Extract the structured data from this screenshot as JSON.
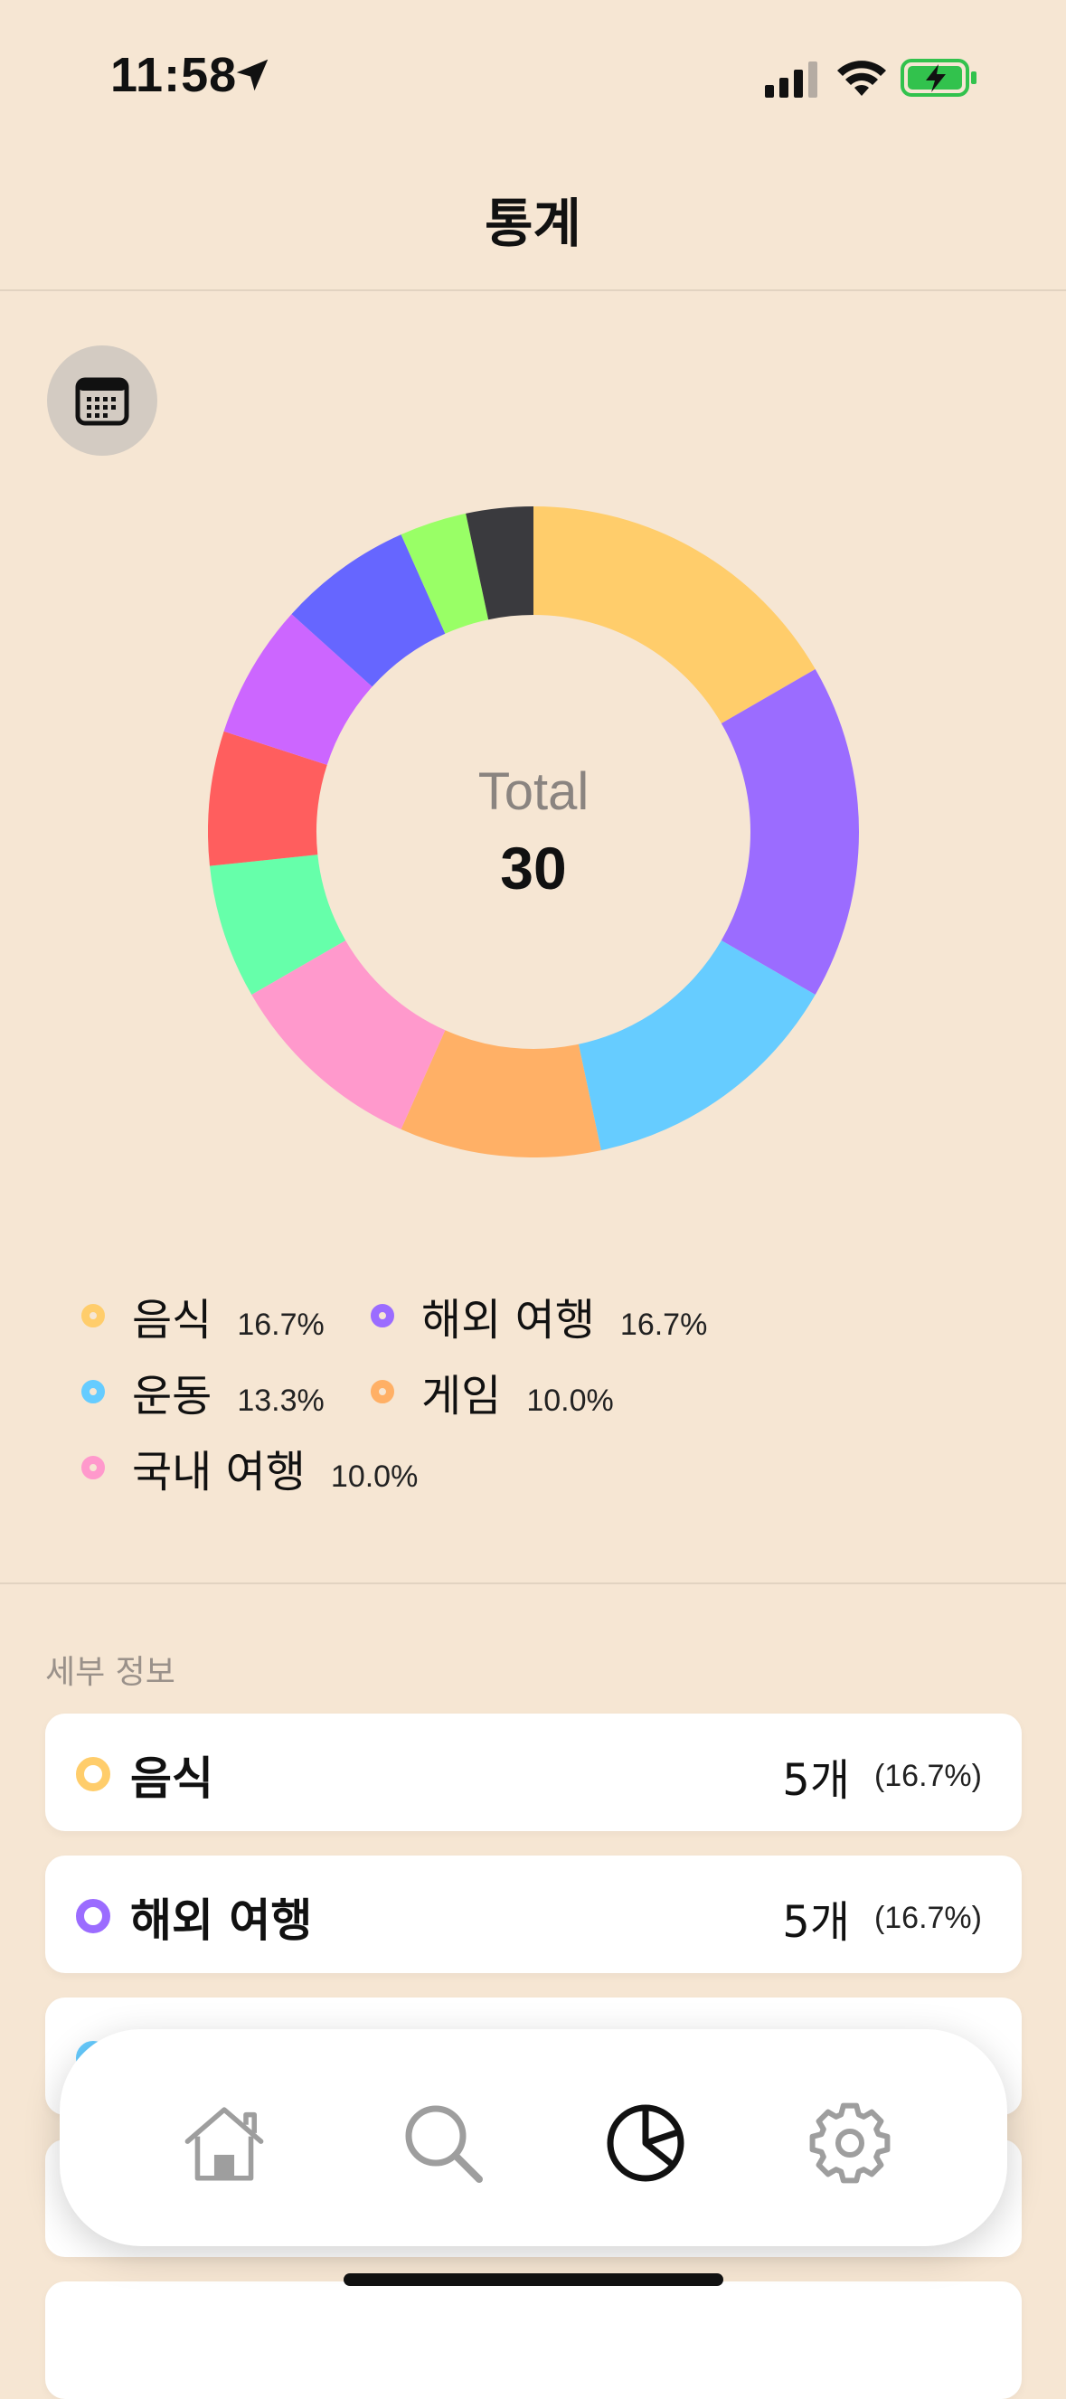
{
  "status_bar": {
    "time": "11:58",
    "icons": [
      "location-arrow-icon",
      "signal-icon",
      "wifi-icon",
      "battery-charging-icon"
    ]
  },
  "header": {
    "title": "통계"
  },
  "calendar_button": {
    "icon": "calendar-icon"
  },
  "chart_data": {
    "type": "pie",
    "center_label": "Total",
    "center_value": "30",
    "slices": [
      {
        "label": "음식",
        "value": 5,
        "color": "#ffcd6b"
      },
      {
        "label": "해외 여행",
        "value": 5,
        "color": "#9b6cff"
      },
      {
        "label": "운동",
        "value": 4,
        "color": "#66ccff"
      },
      {
        "label": "게임",
        "value": 3,
        "color": "#ffb066"
      },
      {
        "label": "국내 여행",
        "value": 3,
        "color": "#ff99cc"
      },
      {
        "label": "",
        "value": 2,
        "color": "#66ffaa"
      },
      {
        "label": "",
        "value": 2,
        "color": "#ff5e5e"
      },
      {
        "label": "",
        "value": 2,
        "color": "#cc66ff"
      },
      {
        "label": "",
        "value": 2,
        "color": "#6666ff"
      },
      {
        "label": "",
        "value": 1,
        "color": "#99ff66"
      },
      {
        "label": "",
        "value": 1,
        "color": "#3a3a3e"
      }
    ]
  },
  "legend": {
    "items": [
      {
        "label": "음식",
        "pct": "16.7%",
        "color": "#ffcd6b"
      },
      {
        "label": "해외 여행",
        "pct": "16.7%",
        "color": "#9b6cff"
      },
      {
        "label": "운동",
        "pct": "13.3%",
        "color": "#66ccff"
      },
      {
        "label": "게임",
        "pct": "10.0%",
        "color": "#ffb066"
      },
      {
        "label": "국내 여행",
        "pct": "10.0%",
        "color": "#ff99cc"
      }
    ]
  },
  "details": {
    "section_label": "세부 정보",
    "rows": [
      {
        "name": "음식",
        "count": "5개",
        "pct": "(16.7%)",
        "color": "#ffcd6b"
      },
      {
        "name": "해외 여행",
        "count": "5개",
        "pct": "(16.7%)",
        "color": "#9b6cff"
      }
    ]
  },
  "tab_bar": {
    "tabs": [
      {
        "icon": "home-icon",
        "active": false
      },
      {
        "icon": "search-icon",
        "active": false
      },
      {
        "icon": "pie-chart-icon",
        "active": true
      },
      {
        "icon": "settings-gear-icon",
        "active": false
      }
    ]
  }
}
